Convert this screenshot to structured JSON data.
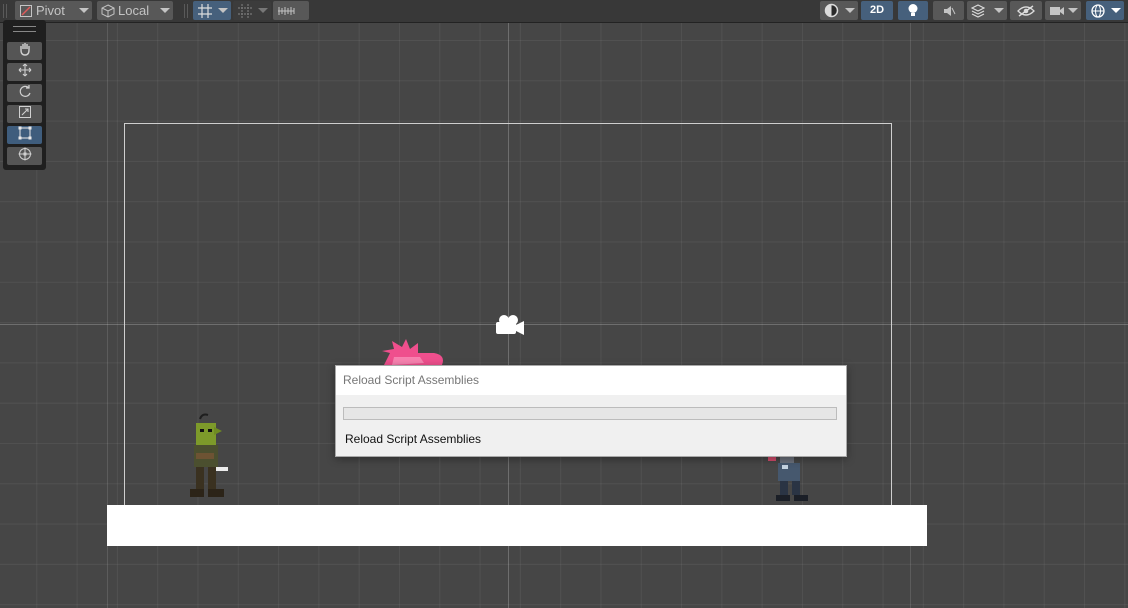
{
  "toolbar": {
    "pivot_label": "Pivot",
    "space_label": "Local",
    "mode_2d_label": "2D",
    "icons": [
      "pivot-icon",
      "local-space-icon",
      "grid-snap-icon",
      "snap-increment-icon",
      "ruler-icon",
      "shading-mode-icon",
      "lighting-icon",
      "audio-icon",
      "effects-icon",
      "visibility-icon",
      "camera-icon",
      "gizmos-icon"
    ]
  },
  "tools": [
    "hand-tool",
    "move-tool",
    "rotate-tool",
    "scale-tool",
    "rect-tool",
    "transform-tool"
  ],
  "active_tool": "rect-tool",
  "dialog": {
    "title": "Reload Script Assemblies",
    "message": "Reload Script Assemblies",
    "progress": 0
  },
  "scene": {
    "sprites": [
      "goblin-sprite",
      "pink-creature-sprite",
      "zombie-sprite"
    ],
    "colors": {
      "background": "#464646",
      "ground": "#ffffff",
      "accent": "#46607c"
    }
  }
}
